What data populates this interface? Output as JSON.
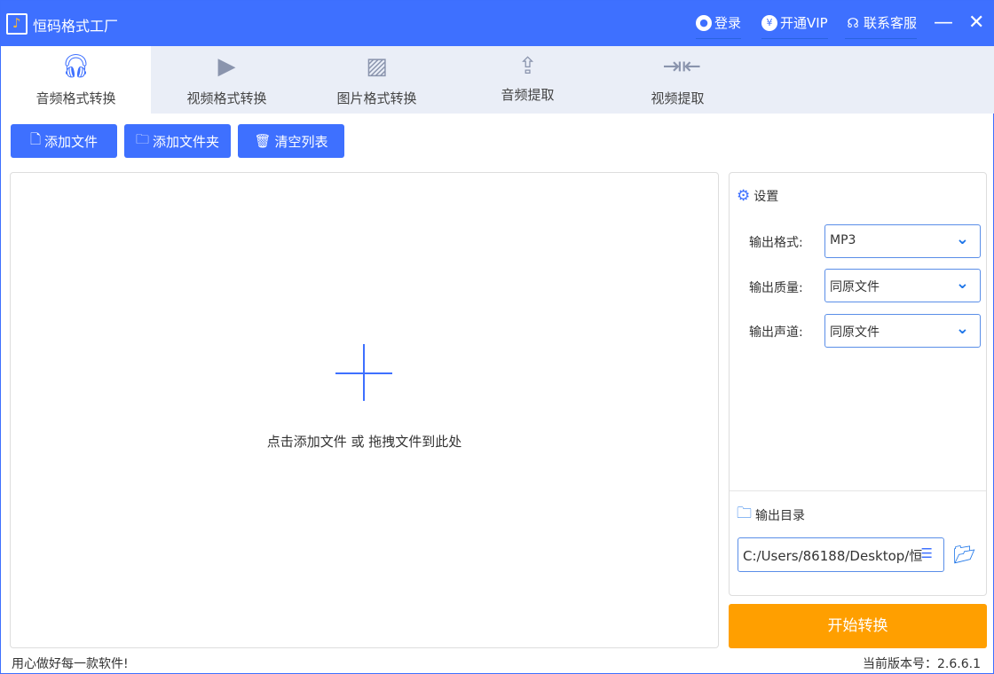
{
  "app": {
    "title": "恒码格式工厂"
  },
  "header": {
    "login": "登录",
    "vip": "开通VIP",
    "support": "联系客服"
  },
  "tabs": [
    {
      "label": "音频格式转换"
    },
    {
      "label": "视频格式转换"
    },
    {
      "label": "图片格式转换"
    },
    {
      "label": "音频提取"
    },
    {
      "label": "视频提取"
    }
  ],
  "toolbar": {
    "add_file": "添加文件",
    "add_folder": "添加文件夹",
    "clear_list": "清空列表"
  },
  "drop": {
    "hint": "点击添加文件 或 拖拽文件到此处"
  },
  "settings": {
    "title": "设置",
    "format_label": "输出格式:",
    "format_value": "MP3",
    "quality_label": "输出质量:",
    "quality_value": "同原文件",
    "channel_label": "输出声道:",
    "channel_value": "同原文件",
    "output_dir_label": "输出目录",
    "output_dir_value": "C:/Users/86188/Desktop/恒"
  },
  "start_button": "开始转换",
  "footer": {
    "slogan": "用心做好每一款软件!",
    "version": "当前版本号：2.6.6.1"
  },
  "colors": {
    "primary": "#3e70ff",
    "accent": "#ff9f00"
  }
}
